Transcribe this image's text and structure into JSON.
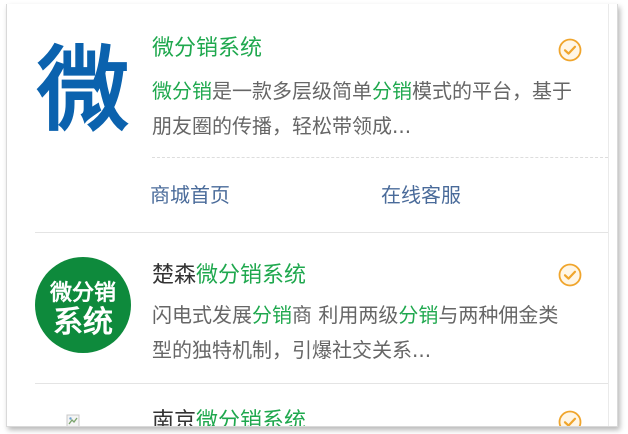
{
  "results": [
    {
      "title": [
        {
          "text": "微分销系统",
          "hl": true
        }
      ],
      "desc": [
        {
          "text": "微分销",
          "hl": true
        },
        {
          "text": "是一款多层级简单",
          "hl": false
        },
        {
          "text": "分销",
          "hl": true
        },
        {
          "text": "模式的平台，基于朋友圈的传播，轻松带领成...",
          "hl": false
        }
      ],
      "logo": {
        "type": "blue-glyph",
        "glyph": "微",
        "color": "#0b62ae"
      },
      "links": [
        "商城首页",
        "在线客服"
      ]
    },
    {
      "title": [
        {
          "text": "楚森",
          "hl": false
        },
        {
          "text": "微分销系统",
          "hl": true
        }
      ],
      "desc": [
        {
          "text": "闪电式发展",
          "hl": false
        },
        {
          "text": "分销",
          "hl": true
        },
        {
          "text": "商 利用两级",
          "hl": false
        },
        {
          "text": "分销",
          "hl": true
        },
        {
          "text": "与两种佣金类型的独特机制，引爆社交关系...",
          "hl": false
        }
      ],
      "logo": {
        "type": "green-circle",
        "line1": "微分销",
        "line2": "系统",
        "color": "#0e8a3c"
      }
    },
    {
      "title": [
        {
          "text": "南京",
          "hl": false
        },
        {
          "text": "微分销系统",
          "hl": true
        }
      ],
      "logo": {
        "type": "broken-image"
      }
    }
  ],
  "colors": {
    "highlight": "#1fa84e",
    "link": "#4a6b9a",
    "check": "#f0a52c"
  },
  "icons": {
    "verified": "check-circle-icon"
  }
}
